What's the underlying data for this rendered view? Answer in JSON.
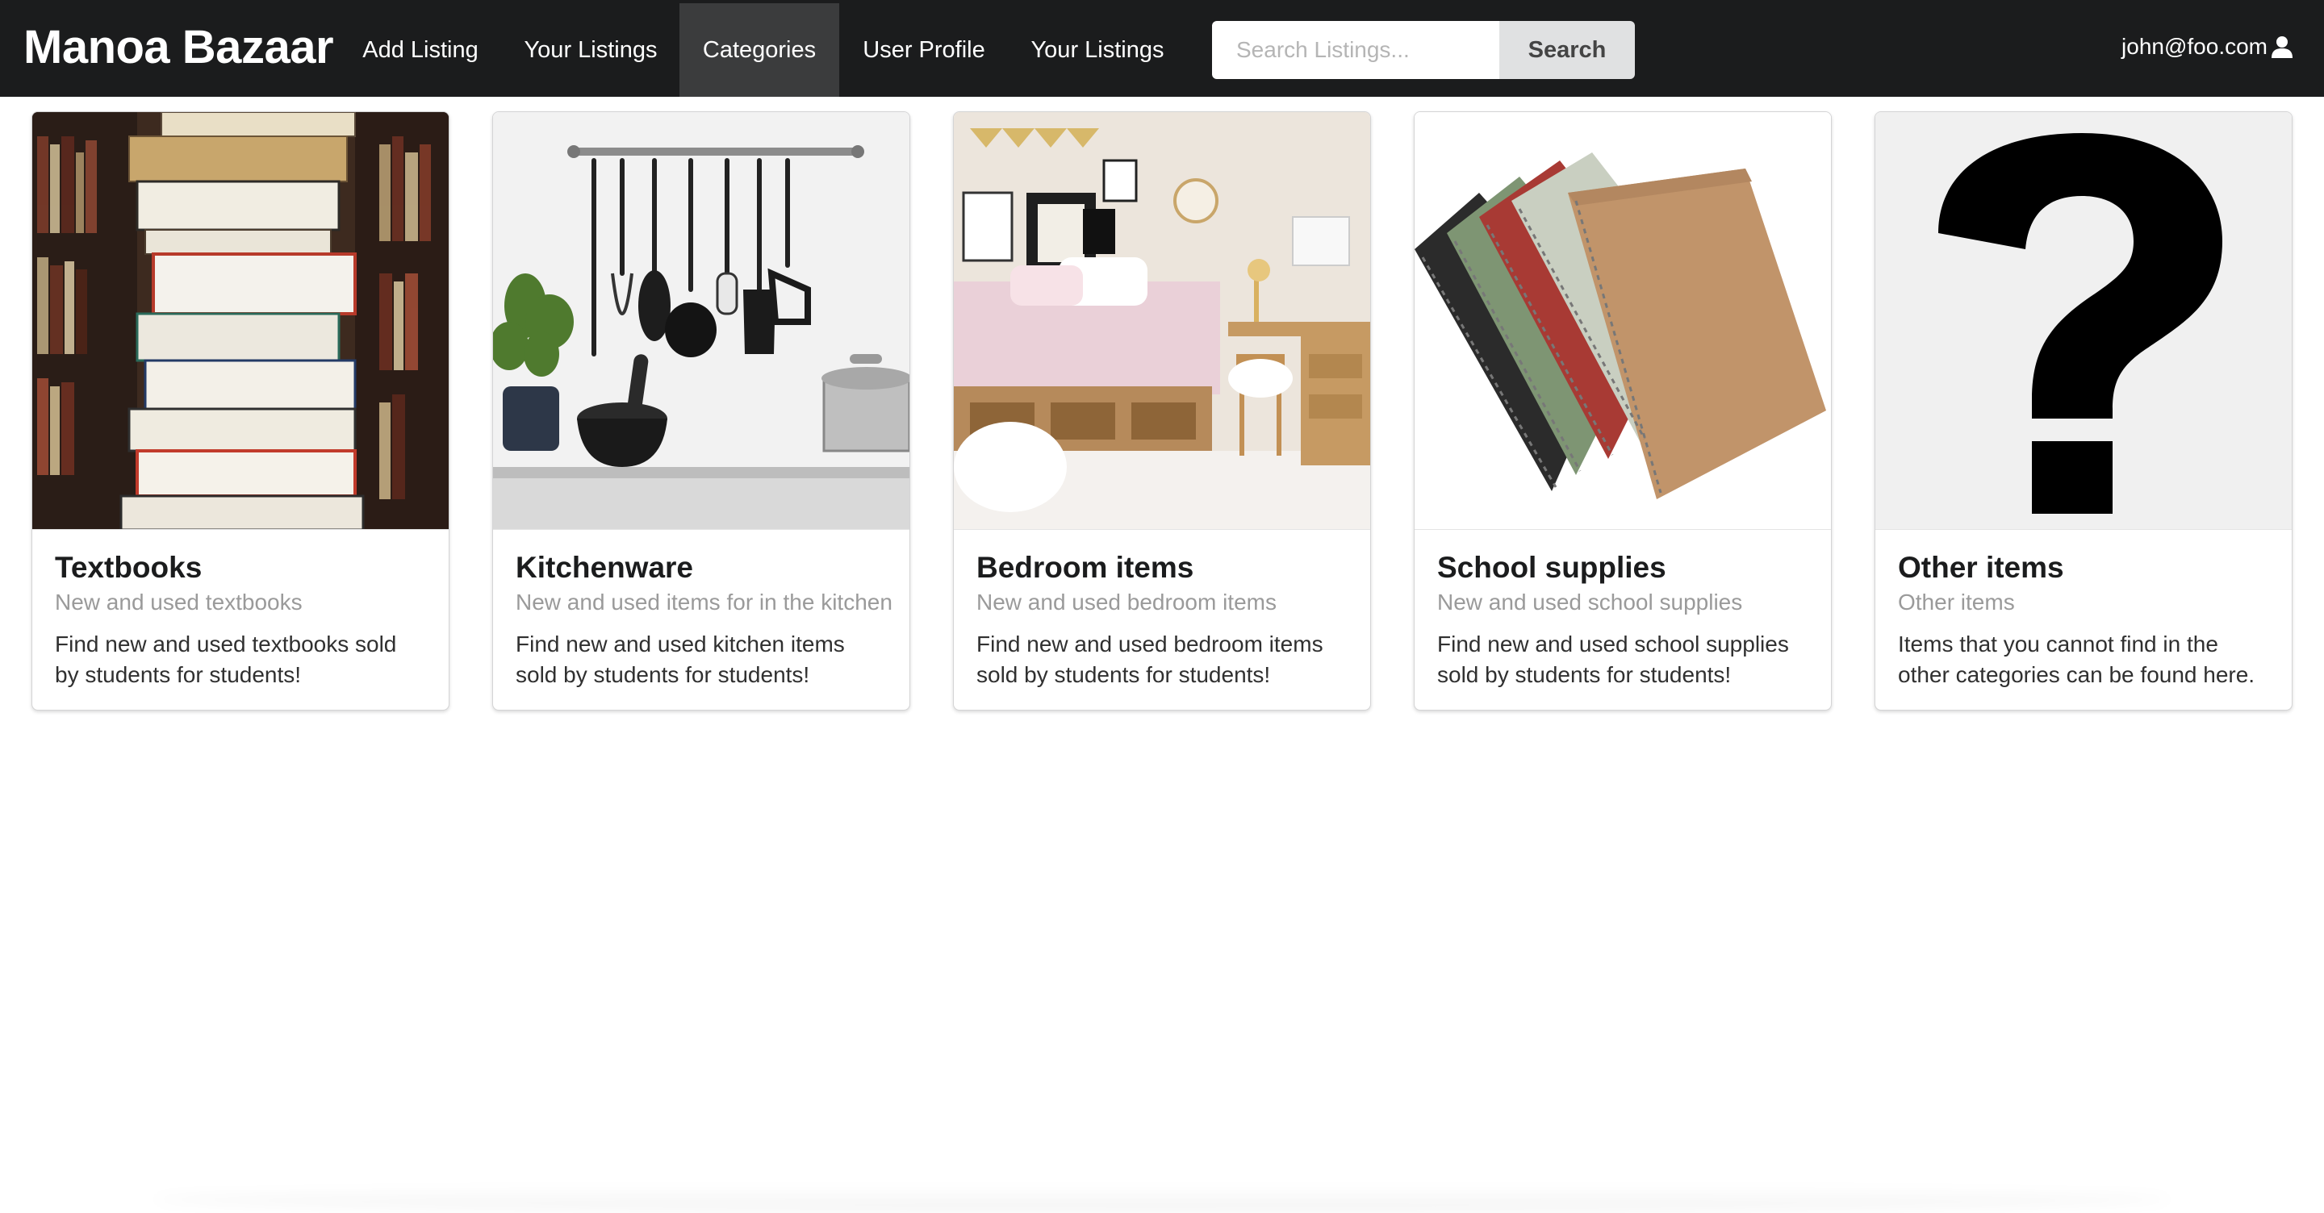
{
  "navbar": {
    "brand": "Manoa Bazaar",
    "items": [
      {
        "label": "Add Listing",
        "active": false
      },
      {
        "label": "Your Listings",
        "active": false
      },
      {
        "label": "Categories",
        "active": true
      },
      {
        "label": "User Profile",
        "active": false
      },
      {
        "label": "Your Listings",
        "active": false
      }
    ],
    "search": {
      "placeholder": "Search Listings...",
      "value": "",
      "button_label": "Search"
    },
    "user": {
      "email": "john@foo.com",
      "icon": "user-icon"
    }
  },
  "categories": [
    {
      "title": "Textbooks",
      "meta": "New and used textbooks",
      "description": "Find new and used textbooks sold by students for students!",
      "image": "stack-of-books-image"
    },
    {
      "title": "Kitchenware",
      "meta": "New and used items for in the kitchen",
      "description": "Find new and used kitchen items sold by students for students!",
      "image": "kitchen-utensils-image"
    },
    {
      "title": "Bedroom items",
      "meta": "New and used bedroom items",
      "description": "Find new and used bedroom items sold by students for students!",
      "image": "dorm-bedroom-image"
    },
    {
      "title": "School supplies",
      "meta": "New and used school supplies",
      "description": "Find new and used school supplies sold by students for students!",
      "image": "spiral-notebooks-image"
    },
    {
      "title": "Other items",
      "meta": "Other items",
      "description": "Items that you cannot find in the other categories can be found here.",
      "image": "question-mark-image"
    }
  ],
  "colors": {
    "navbar_bg": "#1b1c1d",
    "active_item_bg": "#3b3c3d",
    "search_button_bg": "#e0e1e2",
    "meta_text": "#9a9a9a"
  }
}
